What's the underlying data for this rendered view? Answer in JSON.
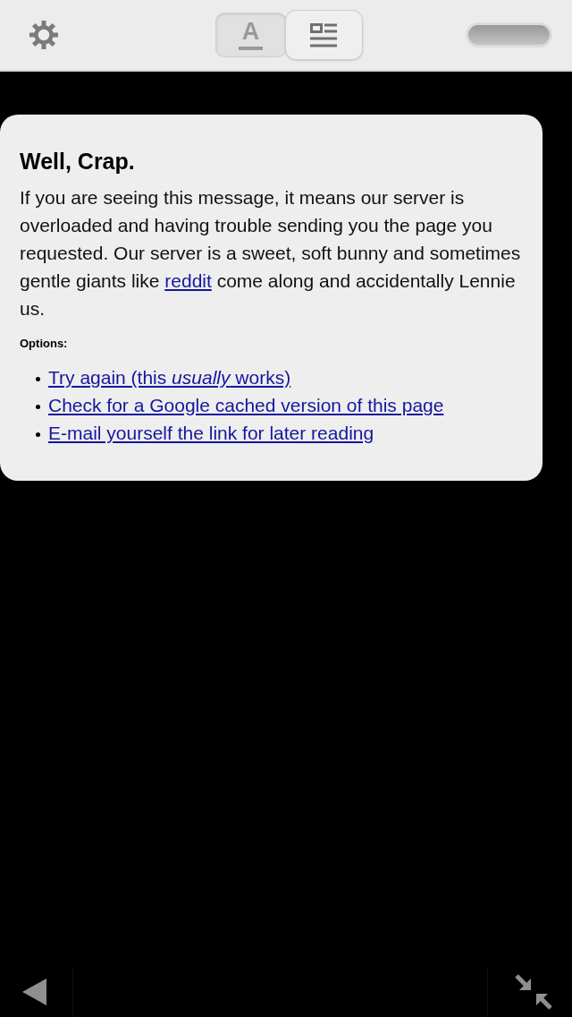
{
  "toolbar": {
    "view_modes": [
      {
        "kind": "text",
        "label": "A",
        "selected": false
      },
      {
        "kind": "layout",
        "selected": true
      }
    ]
  },
  "error_card": {
    "title": "Well, Crap.",
    "message": {
      "before": "If you are seeing this message, it means our server is overloaded and having trouble sending you the page you requested. Our server is a sweet, soft bunny and sometimes gentle giants like",
      "link": "reddit",
      "after": "come along and accidentally Lennie us."
    },
    "options_label": "Options:",
    "options": [
      "Try again (this *usually* works)",
      "Check for a Google cached version of this page",
      "E-mail yourself the link for later reading"
    ]
  }
}
